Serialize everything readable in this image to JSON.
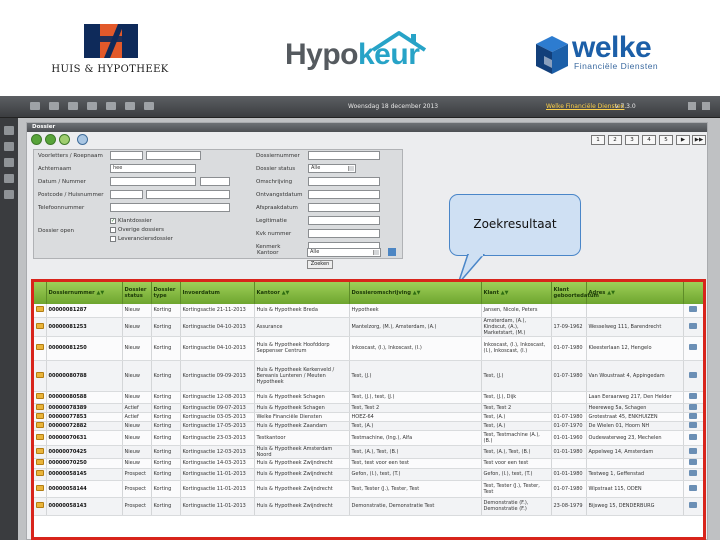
{
  "logos": {
    "huis_hypotheek": "HUIS & HYPOTHEEK",
    "hypokeur_part1": "Hypo",
    "hypokeur_part2": "keur",
    "welke": "welke",
    "welke_sub": "Financiële Diensten"
  },
  "topbar": {
    "date": "Woensdag 18 december 2013",
    "app_name": "Welke Financiële Diensten",
    "version": "v 7.3.0"
  },
  "panel": {
    "title": "Dossier"
  },
  "pager": {
    "pages": [
      "1",
      "2",
      "3",
      "4",
      "5",
      "▶",
      "▶▶"
    ]
  },
  "form": {
    "labels": {
      "voorletters": "Voorletters / Roepnaam",
      "achternaam": "Achternaam",
      "geboortedatum": "Datum / Nummer",
      "postcode": "Postcode / Huisnummer",
      "telefoon": "Telefoonnummer",
      "dossier_open": "Dossier open",
      "dossiernummer": "Dossiernummer",
      "dossierstatus": "Dossier status",
      "onderwerp": "Omschrijving",
      "ontvanger": "Ontvangstdatum",
      "vervolgdatum": "Afspraakdatum",
      "legitimatie": "Legitimatie",
      "kvk": "Kvk nummer",
      "kenmerk": "Kenmerk",
      "kantoor": "Kantoor"
    },
    "values": {
      "achternaam": "hee",
      "dossierstatus": "Alle",
      "kantoor": "Alle"
    },
    "checks": {
      "klantdossier": "Klantdossier",
      "overige": "Overige dossiers",
      "leveranciers": "Leveranciersdossier"
    },
    "search_button": "Zoeken"
  },
  "callout": "Zoekresultaat",
  "table": {
    "columns": [
      "Dossiernummer",
      "Dossier status",
      "Dossier type",
      "Invoerdatum",
      "Kantoor",
      "Dossieromschrijving",
      "Klant",
      "Klant geboortedatum",
      "Adres"
    ],
    "rows": [
      [
        "00000081287",
        "Nieuw",
        "Korting",
        "Kortingsactie 21-11-2013",
        "Huis & Hypotheek Breda",
        "Hypotheek",
        "Jansen, Nicole, Peters",
        "",
        ""
      ],
      [
        "00000081253",
        "Nieuw",
        "Korting",
        "Kortingsactie 04-10-2013",
        "Assurance",
        "Mantelzorg, (M.), Amsterdam, (A.)",
        "Amsterdam, (A.), Kindscut, (A.), Marketstart, (M.)",
        "17-09-1962",
        "Wesselweg 111, Barendrecht"
      ],
      [
        "00000081250",
        "Nieuw",
        "Korting",
        "Kortingsactie 04-10-2013",
        "Huis & Hypotheek Hoofddorp Seppenser Centrum",
        "Inkoscast, (I.), Inkoscast, (I.)",
        "Inkoscast, (I.), Inkoscast, (I.), Inkoscast, (I.)",
        "01-07-1980",
        "Kleesterlaan 12, Hengelo"
      ],
      [
        "00000080788",
        "Nieuw",
        "Korting",
        "Kortingsactie 09-09-2013",
        "Huis & Hypotheek Kerkenveld / Bereanis Lunteren / Meuten Hypotheek",
        "Test, (J.)",
        "Test, (J.)",
        "01-07-1980",
        "Van Woustraat 4, Appingedam"
      ],
      [
        "00000080588",
        "Nieuw",
        "Korting",
        "Kortingsactie 12-08-2013",
        "Huis & Hypotheek Schagen",
        "Test, (J.), test, (J.)",
        "Test, (J.), Dijk",
        "",
        "Laan Eeraarweg 217, Den Helder"
      ],
      [
        "00000078389",
        "Actief",
        "Korting",
        "Kortingsactie 09-07-2013",
        "Huis & Hypotheek Schagen",
        "Test, Test 2",
        "Test, Test 2",
        "",
        "Heereweg 5a, Schagen"
      ],
      [
        "00000077853",
        "Actief",
        "Korting",
        "Kortingsactie 03-05-2013",
        "Welke Financiële Diensten",
        "HOEZ-64",
        "Test, (A.)",
        "01-07-1980",
        "Grotestraat 45, ENKHUIZEN"
      ],
      [
        "00000072882",
        "Nieuw",
        "Korting",
        "Kortingsactie 17-05-2013",
        "Huis & Hypotheek Zaandam",
        "Test, (A.)",
        "Test, (A.)",
        "01-07-1970",
        "De Wielen 01, Hoorn NH"
      ],
      [
        "00000070631",
        "Nieuw",
        "Korting",
        "Kortingsactie 23-03-2013",
        "Testkantoor",
        "Testmachine, (Ing.), Alfa",
        "Test, Testmachine (A.), (B.)",
        "01-01-1960",
        "Oudewaterweg 23, Mechelen"
      ],
      [
        "00000070425",
        "Nieuw",
        "Korting",
        "Kortingsactie 12-03-2013",
        "Huis & Hypotheek Amsterdam Noord",
        "Test, (A.), Test, (B.)",
        "Test, (A.), Test, (B.)",
        "01-01-1980",
        "Appelweg 14, Amsterdam"
      ],
      [
        "00000070250",
        "Nieuw",
        "Korting",
        "Kortingsactie 14-03-2013",
        "Huis & Hypotheek Zwijndrecht",
        "Test, test voor een test",
        "Test voor een test",
        "",
        ""
      ],
      [
        "00000058145",
        "Prospect",
        "Korting",
        "Kortingsactie 11-01-2013",
        "Huis & Hypotheek Zwijndrecht",
        "Gefon, (I.), test, (T.)",
        "Gefon, (I.), test, (T.)",
        "01-01-1980",
        "Testweg 1, Geffenstad"
      ],
      [
        "00000058144",
        "Prospect",
        "Korting",
        "Kortingsactie 11-01-2013",
        "Huis & Hypotheek Zwijndrecht",
        "Test, Tester (J.), Tester, Test",
        "Test, Tester (J.), Tester, Test",
        "01-07-1980",
        "Wipstraat 115, ODEN"
      ],
      [
        "00000058143",
        "Prospect",
        "Korting",
        "Kortingsactie 11-01-2013",
        "Huis & Hypotheek Zwijndrecht",
        "Demonstratie, Demonstratie Test",
        "Demonstratie (F.), Demonstratie (F.)",
        "23-08-1979",
        "Bijsweg 15, DENDERBURG"
      ]
    ]
  },
  "colors": {
    "accent_green": "#7bb43a",
    "highlight_red": "#d8241b",
    "callout_blue": "#4a86c8",
    "hypokeur_blue": "#27a3c7",
    "welke_blue": "#1c5fa8"
  }
}
